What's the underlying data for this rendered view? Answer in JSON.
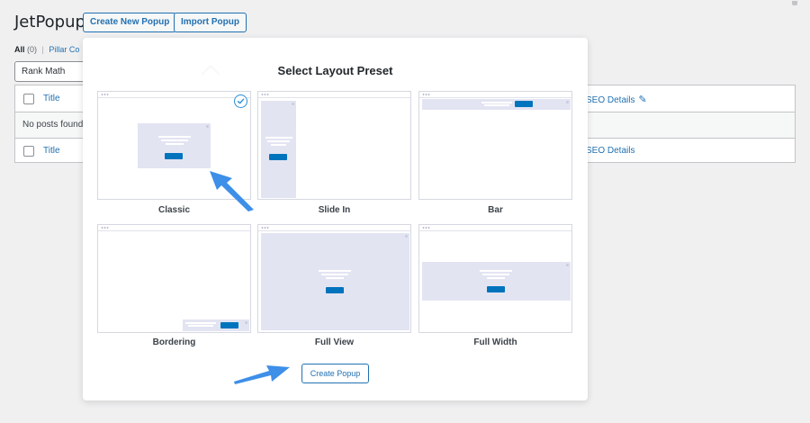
{
  "header": {
    "title": "JetPopup",
    "create_new": "Create New Popup",
    "import": "Import Popup"
  },
  "filters": {
    "all_label": "All",
    "all_count": "(0)",
    "separator": "|",
    "pillar": "Pillar Co"
  },
  "select": {
    "value": "Rank Math"
  },
  "table": {
    "header_title": "Title",
    "header_seo": "SEO Details",
    "empty": "No posts found.",
    "footer_title": "Title",
    "footer_seo": "SEO Details"
  },
  "modal": {
    "title": "Select Layout Preset",
    "presets": [
      {
        "label": "Classic",
        "selected": true
      },
      {
        "label": "Slide In",
        "selected": false
      },
      {
        "label": "Bar",
        "selected": false
      },
      {
        "label": "Bordering",
        "selected": false
      },
      {
        "label": "Full View",
        "selected": false
      },
      {
        "label": "Full Width",
        "selected": false
      }
    ],
    "create_button": "Create Popup"
  },
  "colors": {
    "accent": "#2271b1",
    "preview_button": "#0073bd",
    "preview_fill": "#e3e4f2",
    "arrow": "#3d8fe8"
  },
  "icons": {
    "selected": "check-circle-icon",
    "edit": "pencil-icon",
    "pointer": "arrow-pointer-icon"
  }
}
